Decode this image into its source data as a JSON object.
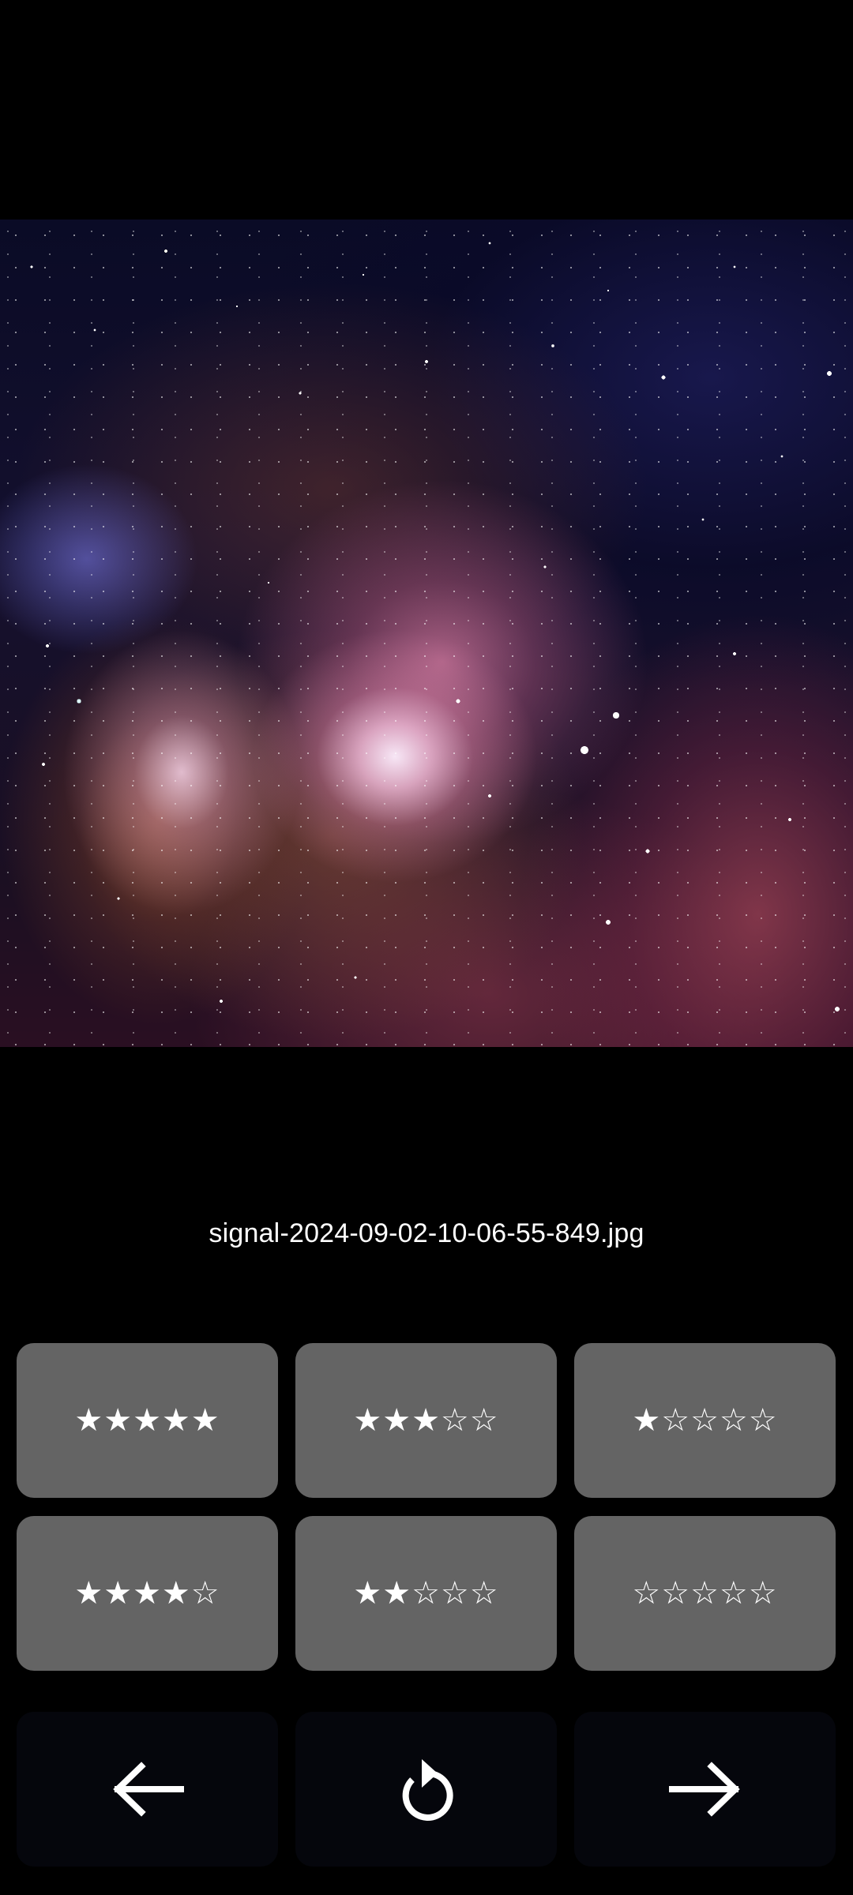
{
  "photo": {
    "alt": "Nebula photograph"
  },
  "file": {
    "name": "signal-2024-09-02-10-06-55-849.jpg"
  },
  "ratings": {
    "row1": [
      {
        "label": "★★★★★",
        "stars": 5
      },
      {
        "label": "★★★☆☆",
        "stars": 3
      },
      {
        "label": "★☆☆☆☆",
        "stars": 1
      }
    ],
    "row2": [
      {
        "label": "★★★★☆",
        "stars": 4
      },
      {
        "label": "★★☆☆☆",
        "stars": 2
      },
      {
        "label": "☆☆☆☆☆",
        "stars": 0
      }
    ]
  },
  "navigation": {
    "previous_icon": "arrow-left-icon",
    "undo_icon": "rotate-ccw-icon",
    "next_icon": "arrow-right-icon"
  },
  "colors": {
    "background": "#000000",
    "rating_button": "#646464",
    "nav_button": "#05060c",
    "text": "#ffffff"
  }
}
